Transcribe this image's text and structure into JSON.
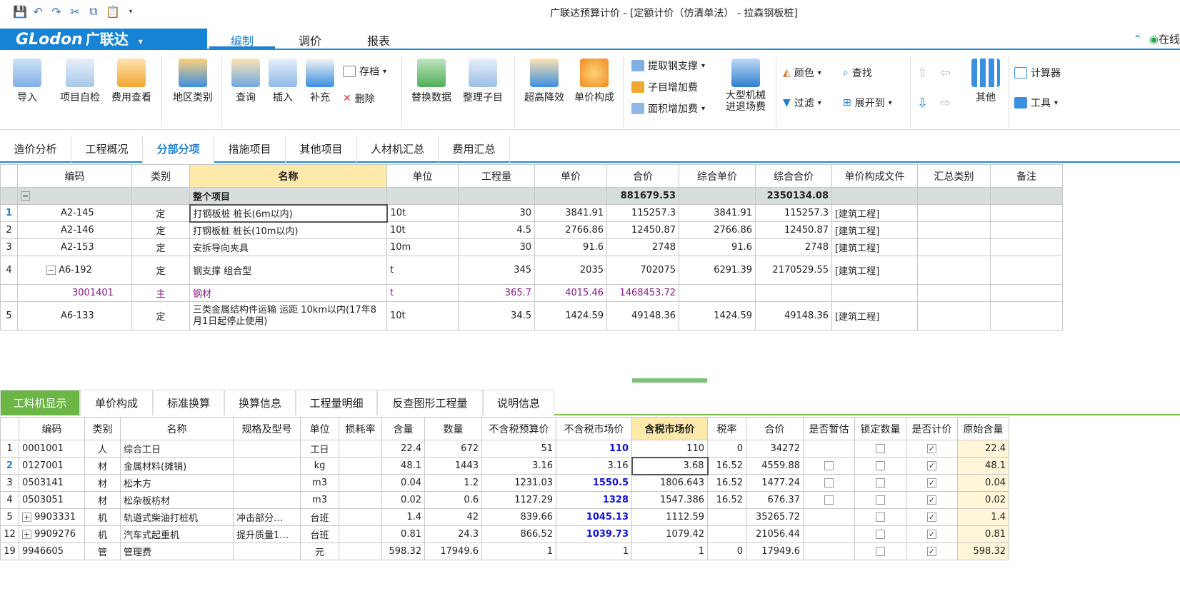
{
  "window": {
    "title": "广联达预算计价 - [定额计价（仿清单法） - 拉森钢板桩]",
    "online_label": "在线"
  },
  "logo": {
    "brand": "GLodon",
    "cn": "广联达",
    "arrow": "▾"
  },
  "menu": {
    "tabs": [
      "编制",
      "调价",
      "报表"
    ]
  },
  "ribbon": {
    "big": [
      "导入",
      "项目自检",
      "费用查看",
      "地区类别",
      "查询",
      "插入",
      "补充",
      "替换数据",
      "整理子目",
      "超高降效",
      "单价构成",
      "大型机械进退场费",
      "其他"
    ],
    "small": {
      "save": "存档",
      "delete": "删除",
      "steel_support": "提取钢支撑",
      "sub_add": "子目增加费",
      "area_add": "面积增加费",
      "color": "颜色",
      "find": "查找",
      "filter": "过滤",
      "expand": "展开到",
      "calc": "计算器",
      "tools": "工具"
    }
  },
  "tabs_main": [
    "造价分析",
    "工程概况",
    "分部分项",
    "措施项目",
    "其他项目",
    "人材机汇总",
    "费用汇总"
  ],
  "grid1": {
    "headers": [
      "编码",
      "类别",
      "名称",
      "单位",
      "工程量",
      "单价",
      "合价",
      "综合单价",
      "综合合价",
      "单价构成文件",
      "汇总类别",
      "备注"
    ],
    "total": {
      "name": "整个项目",
      "hejia": "881679.53",
      "zonghe": "2350134.08"
    },
    "rows": [
      {
        "num": "1",
        "code": "A2-145",
        "type": "定",
        "name": "打钢板桩 桩长(6m以内)",
        "unit": "10t",
        "qty": "30",
        "price": "3841.91",
        "amount": "115257.3",
        "uprice": "3841.91",
        "uamount": "115257.3",
        "file": "[建筑工程]"
      },
      {
        "num": "2",
        "code": "A2-146",
        "type": "定",
        "name": "打钢板桩 桩长(10m以内)",
        "unit": "10t",
        "qty": "4.5",
        "price": "2766.86",
        "amount": "12450.87",
        "uprice": "2766.86",
        "uamount": "12450.87",
        "file": "[建筑工程]"
      },
      {
        "num": "3",
        "code": "A2-153",
        "type": "定",
        "name": "安拆导向夹具",
        "unit": "10m",
        "qty": "30",
        "price": "91.6",
        "amount": "2748",
        "uprice": "91.6",
        "uamount": "2748",
        "file": "[建筑工程]"
      },
      {
        "num": "4",
        "code": "A6-192",
        "type": "定",
        "name": "钢支撑 组合型",
        "unit": "t",
        "qty": "345",
        "price": "2035",
        "amount": "702075",
        "uprice": "6291.39",
        "uamount": "2170529.55",
        "file": "[建筑工程]"
      },
      {
        "num": "",
        "code": "3001401",
        "type": "主",
        "name": "钢材",
        "unit": "t",
        "qty": "365.7",
        "price": "4015.46",
        "amount": "1468453.72",
        "uprice": "",
        "uamount": "",
        "file": ""
      },
      {
        "num": "5",
        "code": "A6-133",
        "type": "定",
        "name": "三类金属结构件运输 运距 10km以内(17年8月1日起停止使用)",
        "unit": "10t",
        "qty": "34.5",
        "price": "1424.59",
        "amount": "49148.36",
        "uprice": "1424.59",
        "uamount": "49148.36",
        "file": "[建筑工程]"
      }
    ]
  },
  "tabs_bottom": [
    "工料机显示",
    "单价构成",
    "标准换算",
    "换算信息",
    "工程量明细",
    "反查图形工程量",
    "说明信息"
  ],
  "grid2": {
    "headers": [
      "编码",
      "类别",
      "名称",
      "规格及型号",
      "单位",
      "损耗率",
      "含量",
      "数量",
      "不含税预算价",
      "不含税市场价",
      "含税市场价",
      "税率",
      "合价",
      "是否暂估",
      "锁定数量",
      "是否计价",
      "原始含量"
    ],
    "rows": [
      {
        "num": "1",
        "code": "0001001",
        "type": "人",
        "name": "综合工日",
        "spec": "",
        "unit": "工日",
        "loss": "",
        "content": "22.4",
        "qty": "672",
        "bud": "51",
        "mkt": "110",
        "taxmkt": "110",
        "rate": "0",
        "amount": "34272",
        "orig": "22.4"
      },
      {
        "num": "2",
        "code": "0127001",
        "type": "材",
        "name": "金属材料(摊销)",
        "spec": "",
        "unit": "kg",
        "loss": "",
        "content": "48.1",
        "qty": "1443",
        "bud": "3.16",
        "mkt": "3.16",
        "taxmkt": "3.68",
        "rate": "16.52",
        "amount": "4559.88",
        "orig": "48.1"
      },
      {
        "num": "3",
        "code": "0503141",
        "type": "材",
        "name": "松木方",
        "spec": "",
        "unit": "m3",
        "loss": "",
        "content": "0.04",
        "qty": "1.2",
        "bud": "1231.03",
        "mkt": "1550.5",
        "taxmkt": "1806.643",
        "rate": "16.52",
        "amount": "1477.24",
        "orig": "0.04"
      },
      {
        "num": "4",
        "code": "0503051",
        "type": "材",
        "name": "松杂板枋材",
        "spec": "",
        "unit": "m3",
        "loss": "",
        "content": "0.02",
        "qty": "0.6",
        "bud": "1127.29",
        "mkt": "1328",
        "taxmkt": "1547.386",
        "rate": "16.52",
        "amount": "676.37",
        "orig": "0.02"
      },
      {
        "num": "5",
        "code": "9903331",
        "type": "机",
        "name": "轨道式柴油打桩机",
        "spec": "冲击部分…",
        "unit": "台班",
        "loss": "",
        "content": "1.4",
        "qty": "42",
        "bud": "839.66",
        "mkt": "1045.13",
        "taxmkt": "1112.59",
        "rate": "",
        "amount": "35265.72",
        "orig": "1.4"
      },
      {
        "num": "12",
        "code": "9909276",
        "type": "机",
        "name": "汽车式起重机",
        "spec": "提升质量1…",
        "unit": "台班",
        "loss": "",
        "content": "0.81",
        "qty": "24.3",
        "bud": "866.52",
        "mkt": "1039.73",
        "taxmkt": "1079.42",
        "rate": "",
        "amount": "21056.44",
        "orig": "0.81"
      },
      {
        "num": "19",
        "code": "9946605",
        "type": "管",
        "name": "管理费",
        "spec": "",
        "unit": "元",
        "loss": "",
        "content": "598.32",
        "qty": "17949.6",
        "bud": "1",
        "mkt": "1",
        "taxmkt": "1",
        "rate": "0",
        "amount": "17949.6",
        "orig": "598.32"
      }
    ]
  },
  "colors": {
    "brand": "#1783d4",
    "accent": "#1e7fd0",
    "green_tab": "#6cb645",
    "total_row": "#d8dede",
    "header_hl": "#fde9a9",
    "sub_row": "#8b1a8b",
    "market_blue": "#1010e0"
  }
}
